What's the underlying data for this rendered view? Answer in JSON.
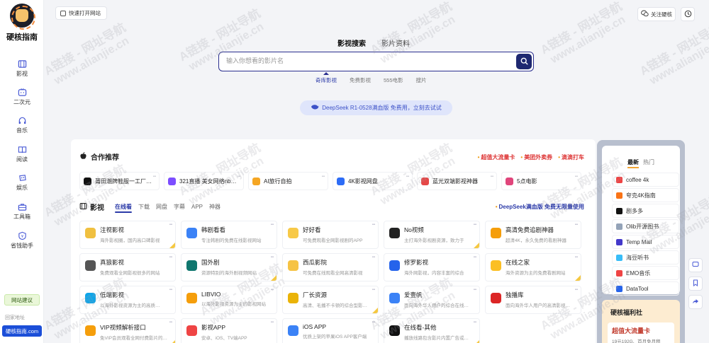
{
  "sidebar": {
    "logo_text": "硬核指南",
    "items": [
      {
        "label": "影视",
        "icon": "film-icon"
      },
      {
        "label": "二次元",
        "icon": "tv-icon"
      },
      {
        "label": "音乐",
        "icon": "headphones-icon"
      },
      {
        "label": "阅读",
        "icon": "book-icon"
      },
      {
        "label": "娱乐",
        "icon": "game-icon"
      },
      {
        "label": "工具箱",
        "icon": "toolbox-icon"
      },
      {
        "label": "省钱助手",
        "icon": "wallet-icon"
      }
    ],
    "feedback_label": "网站建议",
    "address_label": "回家地址",
    "address_button": "硬核指南.com"
  },
  "topbar": {
    "quick_label": "快速打开网站",
    "follow_label": "关注硬核"
  },
  "search": {
    "tabs": [
      "影视搜索",
      "影片资料"
    ],
    "active_tab": 0,
    "placeholder": "输入你想看的影片名",
    "sub_tabs": [
      "奇库影视",
      "免费影视",
      "555电影",
      "搜片"
    ],
    "active_sub_tab": 0,
    "deepseek_text": "DeepSeek R1-0528满血版 免费用，立刻去试试"
  },
  "cooperation": {
    "title": "合作推荐",
    "links": [
      "超值大流量卡",
      "美团外卖券",
      "滴滴打车"
    ],
    "cards": [
      {
        "name": "莆田潮牌鞋服一工厂…",
        "color": "#111111"
      },
      {
        "name": "321直播 美女网络nb…",
        "color": "#7c4dff"
      },
      {
        "name": "AI旅行自拍",
        "color": "#f5a623"
      },
      {
        "name": "4K影视网盘",
        "color": "#2d6cf6"
      },
      {
        "name": "蓝光双端影视神器",
        "color": "#e54848"
      },
      {
        "name": "5点电影",
        "color": "#e0457b"
      }
    ]
  },
  "video": {
    "title": "影视",
    "tabs": [
      "在线看",
      "下载",
      "网盘",
      "字幕",
      "APP",
      "神器"
    ],
    "active_tab": 0,
    "promo": "DeepSeek满血版 免费无限量使用",
    "cards": [
      {
        "name": "注视影视",
        "desc": "海外影视圈，国内高口碑影视",
        "color": "#f0c040"
      },
      {
        "name": "韩剧看看",
        "desc": "专注韩剧的免费在线影视网站",
        "color": "#3b82f6"
      },
      {
        "name": "好好看",
        "desc": "可免费观看全网影视剧的APP",
        "color": "#f7c948"
      },
      {
        "name": "No视频",
        "desc": "主打海外影视剧资源，致力于",
        "color": "#222222"
      },
      {
        "name": "高清免费追剧神器",
        "desc": "超清4K，永久免费的看剧神器",
        "color": "#f59e0b"
      },
      {
        "name": "真狼影视",
        "desc": "免费观看全网影视很多的网站",
        "color": "#555555"
      },
      {
        "name": "国外剧",
        "desc": "资源特别的海外剧视频网站",
        "color": "#0f766e"
      },
      {
        "name": "西瓜影院",
        "desc": "可免费在线观看全网高清影视",
        "color": "#f6c344"
      },
      {
        "name": "修罗影视",
        "desc": "海外网影视，内容丰富的综合",
        "color": "#2563eb"
      },
      {
        "name": "在线之家",
        "desc": "海外资源为主的免费看剧网站",
        "color": "#fbbf24"
      },
      {
        "name": "低端影视",
        "desc": "以海外影视资源为主的高质…",
        "color": "#0ea5e9"
      },
      {
        "name": "LIBVIO",
        "desc": "以海外影视资源为主的影视网站",
        "color": "#f59e0b"
      },
      {
        "name": "厂长资源",
        "desc": "高清、毛播不卡顿的综合型影…",
        "color": "#eab308"
      },
      {
        "name": "爱壹帆",
        "desc": "面向海外华人用户的综合在线…",
        "color": "#3b82f6"
      },
      {
        "name": "独播库",
        "desc": "面向海外华人用户的高清影视…",
        "color": "#dc2626"
      },
      {
        "name": "VIP视频解析接口",
        "desc": "免VIP会员观看全网付费影片的…",
        "color": "#f59e0b"
      },
      {
        "name": "影视APP",
        "desc": "安卓、iOS、TV端APP",
        "color": "#ef4444"
      },
      {
        "name": "iOS APP",
        "desc": "优质上架的苹果iOS APP客户端",
        "color": "#3b82f6"
      },
      {
        "name": "在线看-其他",
        "desc": "播放线路包含影片内置广告或…",
        "color": "#111111"
      }
    ]
  },
  "right": {
    "tabs": [
      "最新",
      "热门"
    ],
    "active_tab": 0,
    "items": [
      {
        "label": "coffee 4k",
        "color": "#ef4444"
      },
      {
        "label": "夸克4K指南",
        "color": "#f97316"
      },
      {
        "label": "剧多多",
        "color": "#111111"
      },
      {
        "label": "Olib开源图书",
        "color": "#94a3b8"
      },
      {
        "label": "Temp Mail",
        "color": "#4338ca"
      },
      {
        "label": "海豆听书",
        "color": "#38bdf8"
      },
      {
        "label": "EMO音乐",
        "color": "#ef4444"
      },
      {
        "label": "DataTool",
        "color": "#2563eb"
      }
    ],
    "welfare_title": "硬核福利社",
    "welfare_card_title": "超值大流量卡",
    "welfare_card_desc": "19元192G、首月免月租"
  },
  "watermark": {
    "line1": "A链接 - 网址导航",
    "line2": "www.alianjie.cn"
  },
  "colors": {
    "accent": "#2b3aa8",
    "search_border": "#2b2f8f",
    "search_button": "#1e2870",
    "address_button": "#1b4ed8",
    "link_red": "#dd3333"
  }
}
